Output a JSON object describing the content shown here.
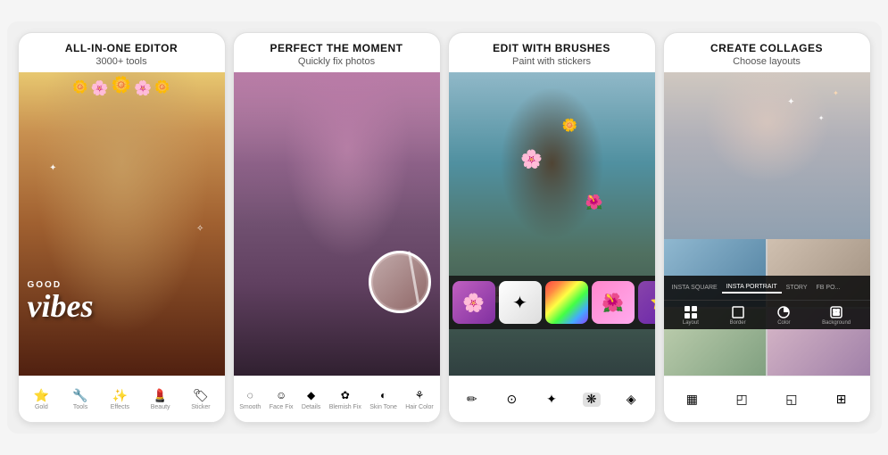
{
  "cards": [
    {
      "id": "editor",
      "title": "ALL-IN-ONE EDITOR",
      "subtitle": "3000+ tools",
      "toolbar_items": [
        "Gold",
        "Tools",
        "Effects",
        "Beauty",
        "Sticker",
        ""
      ]
    },
    {
      "id": "moment",
      "title": "PERFECT THE MOMENT",
      "subtitle": "Quickly fix photos",
      "toolbar_items": [
        "Smooth",
        "Face Fix",
        "Details",
        "Blemish Fix",
        "Skin Tone",
        "Hair Color"
      ]
    },
    {
      "id": "brushes",
      "title": "EDIT WITH BRUSHES",
      "subtitle": "Paint with stickers",
      "toolbar_items": [
        "✎",
        "⊙",
        "✦",
        "❋",
        "◈"
      ]
    },
    {
      "id": "collages",
      "title": "CREATE COLLAGES",
      "subtitle": "Choose layouts",
      "tabs": [
        "INSTA SQUARE",
        "INSTA PORTRAIT",
        "STORY",
        "FB PO..."
      ],
      "active_tab": "INSTA PORTRAIT",
      "tool_items": [
        "Layout",
        "Border",
        "Color",
        "Background"
      ]
    }
  ]
}
